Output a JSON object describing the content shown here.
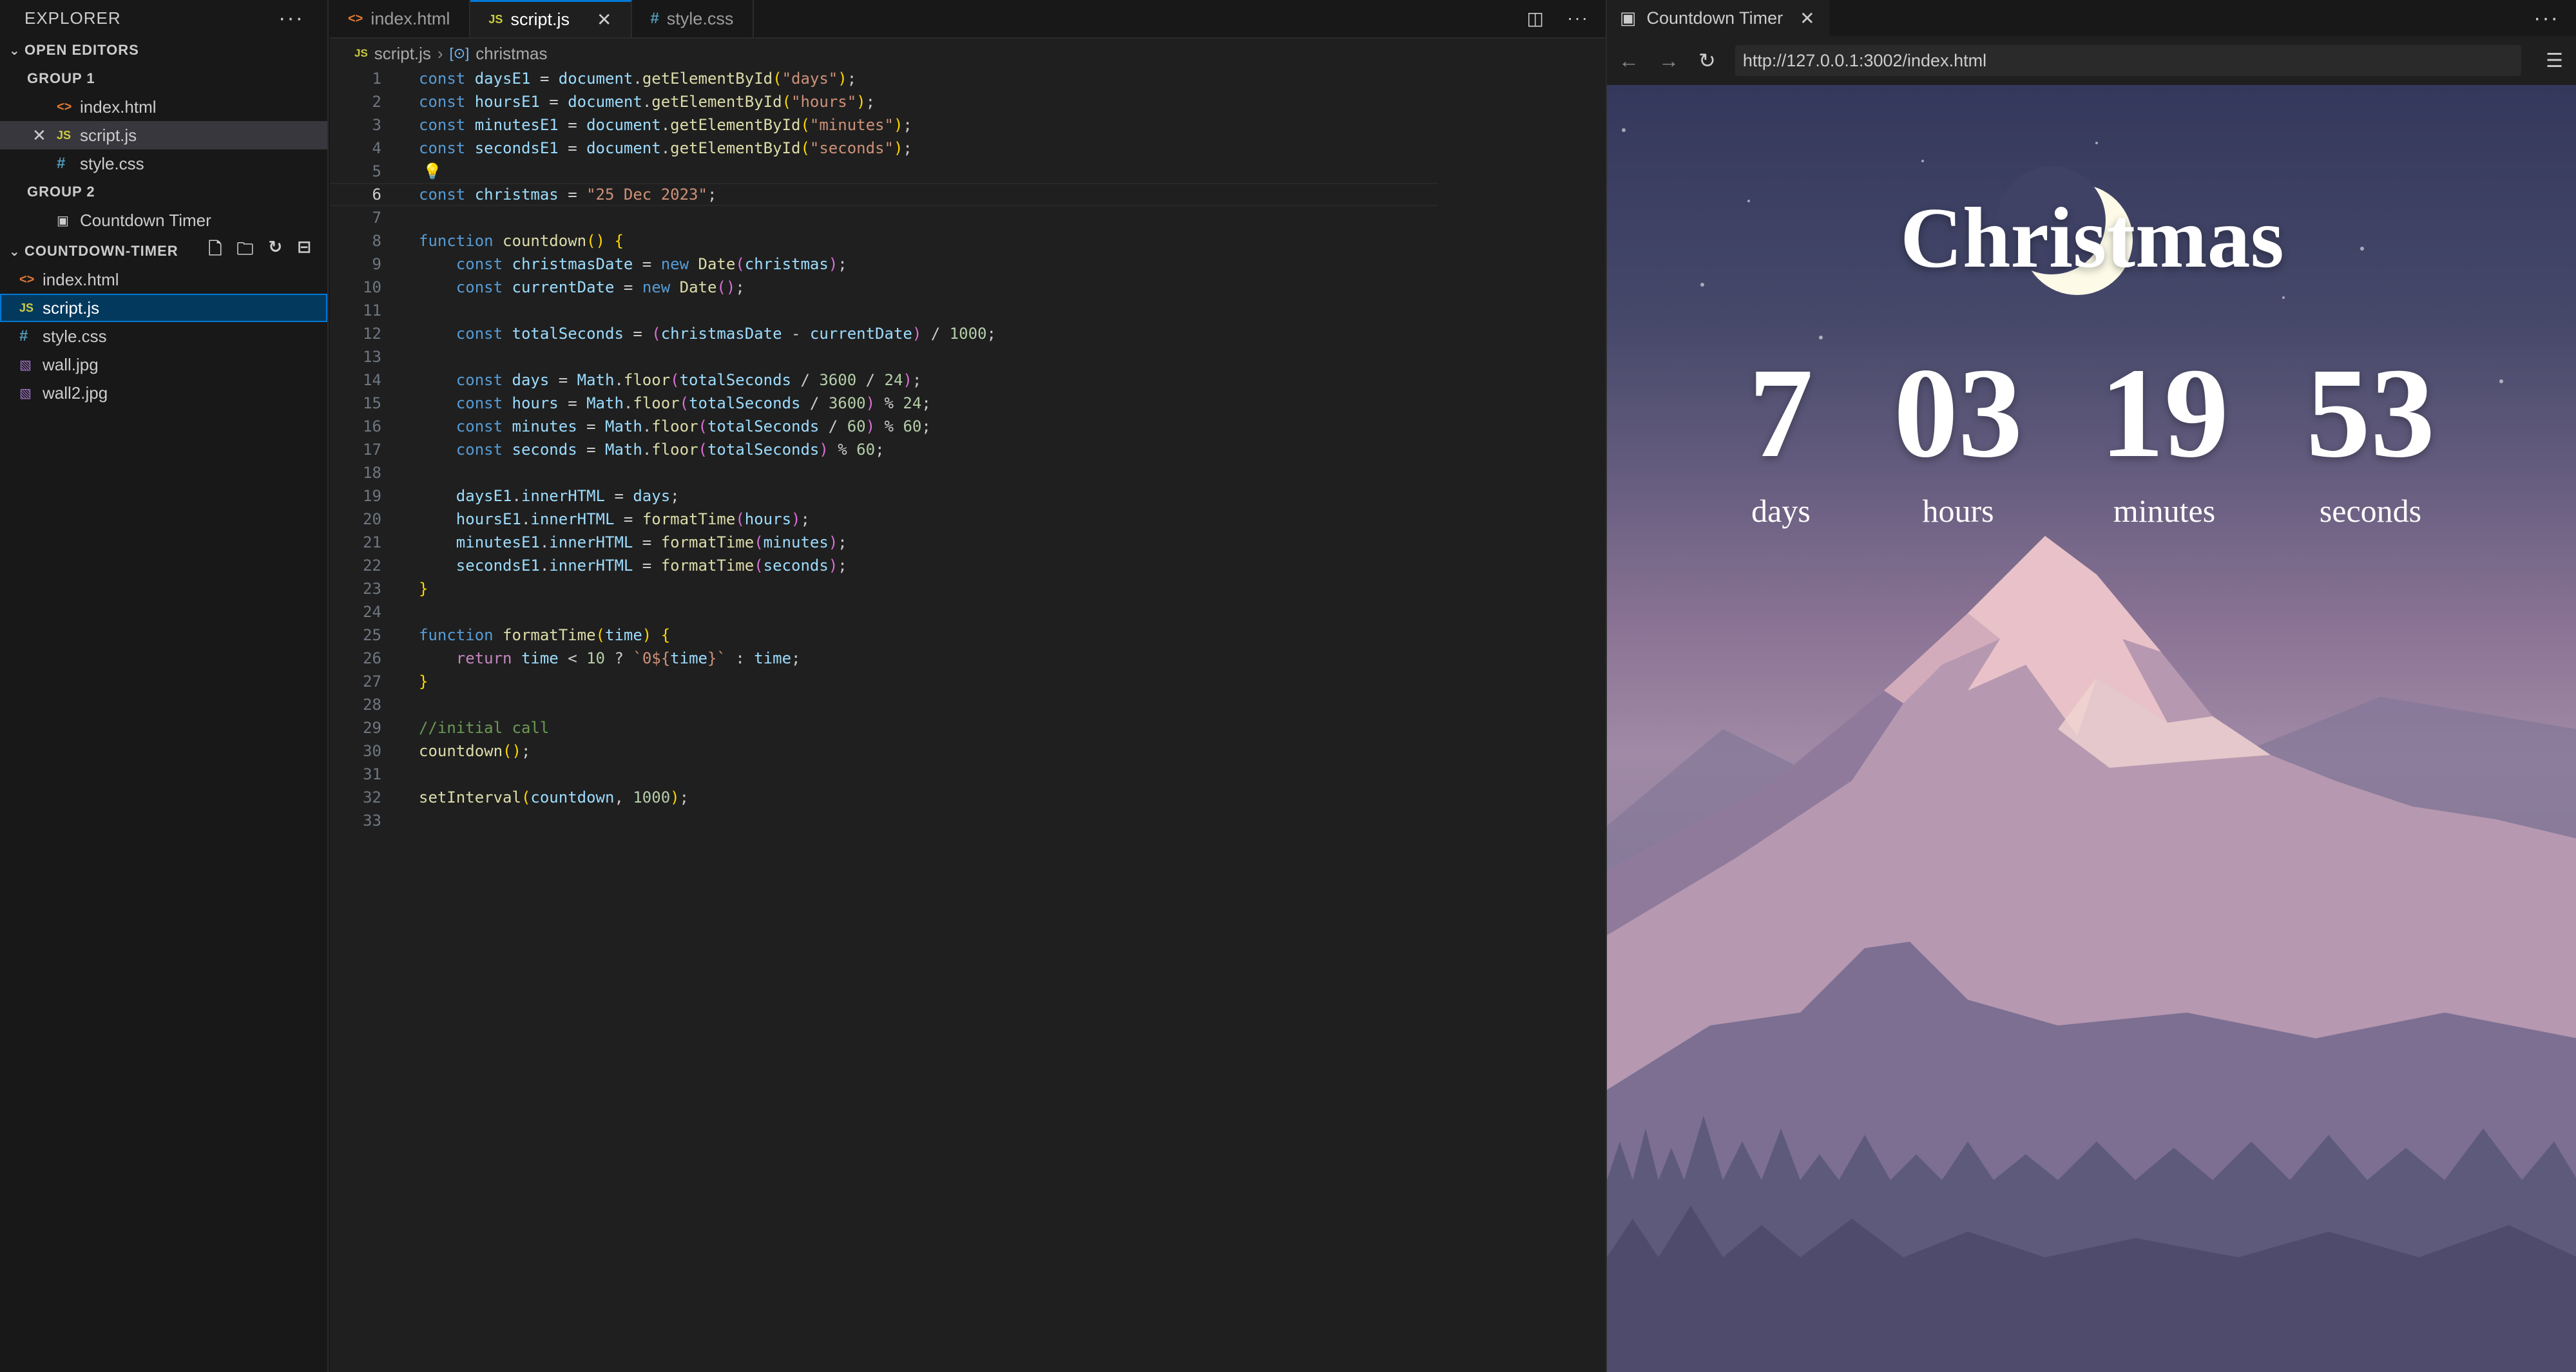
{
  "explorer": {
    "title": "EXPLORER",
    "open_editors": "OPEN EDITORS",
    "group1": "GROUP 1",
    "group1_items": [
      "index.html",
      "script.js",
      "style.css"
    ],
    "group2": "GROUP 2",
    "group2_items": [
      "Countdown Timer"
    ],
    "project": "COUNTDOWN-TIMER",
    "files": [
      "index.html",
      "script.js",
      "style.css",
      "wall.jpg",
      "wall2.jpg"
    ]
  },
  "editor": {
    "tabs": [
      "index.html",
      "script.js",
      "style.css"
    ],
    "breadcrumb_file": "script.js",
    "breadcrumb_symbol": "christmas",
    "line_numbers": [
      "1",
      "2",
      "3",
      "4",
      "5",
      "6",
      "7",
      "8",
      "9",
      "10",
      "11",
      "12",
      "13",
      "14",
      "15",
      "16",
      "17",
      "18",
      "19",
      "20",
      "21",
      "22",
      "23",
      "24",
      "25",
      "26",
      "27",
      "28",
      "29",
      "30",
      "31",
      "32",
      "33"
    ]
  },
  "browser": {
    "tab_title": "Countdown Timer",
    "url": "http://127.0.0.1:3002/index.html",
    "page_title": "Christmas",
    "counters": [
      {
        "value": "7",
        "label": "days"
      },
      {
        "value": "03",
        "label": "hours"
      },
      {
        "value": "19",
        "label": "minutes"
      },
      {
        "value": "53",
        "label": "seconds"
      }
    ]
  },
  "colors": {
    "accent": "#0078d4",
    "selection": "#04395e",
    "keyword": "#569cd6",
    "string": "#ce9178",
    "function": "#dcdcaa",
    "variable": "#9cdcfe"
  },
  "icons": [
    "ellipsis-icon",
    "html-file-icon",
    "js-file-icon",
    "css-file-icon",
    "image-file-icon",
    "preview-icon",
    "new-file-icon",
    "new-folder-icon",
    "refresh-icon",
    "collapse-icon",
    "split-editor-icon",
    "back-icon",
    "forward-icon",
    "reload-icon",
    "menu-icon",
    "lightbulb-icon"
  ]
}
